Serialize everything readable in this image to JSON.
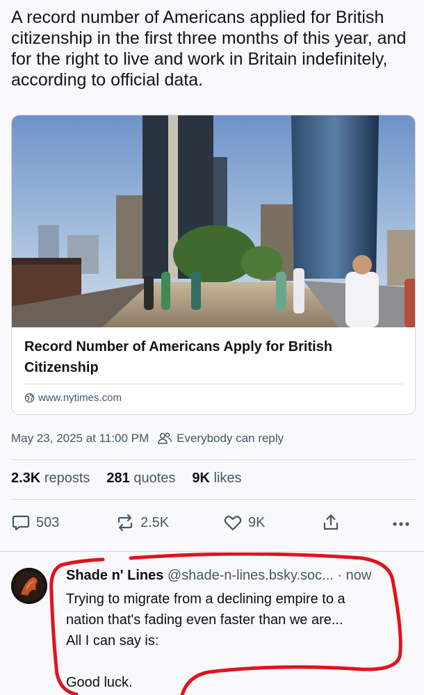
{
  "post": {
    "text": "A record number of Americans applied for British citizenship in the first three months of this year, and for the right to live and work in Britain indefinitely, according to official data."
  },
  "embed": {
    "title": "Record Number of Americans Apply for British Citizenship",
    "domain": "www.nytimes.com",
    "domain_icon": "globe-icon"
  },
  "meta": {
    "timestamp": "May 23, 2025 at 11:00 PM",
    "reply_setting": "Everybody can reply",
    "reply_setting_icon": "people-icon"
  },
  "stats": {
    "reposts_count": "2.3K",
    "reposts_label": "reposts",
    "quotes_count": "281",
    "quotes_label": "quotes",
    "likes_count": "9K",
    "likes_label": "likes"
  },
  "actions": {
    "replies": "503",
    "reposts": "2.5K",
    "likes": "9K"
  },
  "reply": {
    "name": "Shade n' Lines",
    "handle": "@shade-n-lines.bsky.soc...",
    "time": "· now",
    "body_lines": [
      "Trying to migrate from a declining empire to a",
      "nation that's fading even faster than we are...",
      "All I can say is:",
      "",
      "Good luck."
    ]
  },
  "colors": {
    "accent_text": "#42576c",
    "divider": "#d4d9df",
    "annotation": "#e0141c"
  }
}
